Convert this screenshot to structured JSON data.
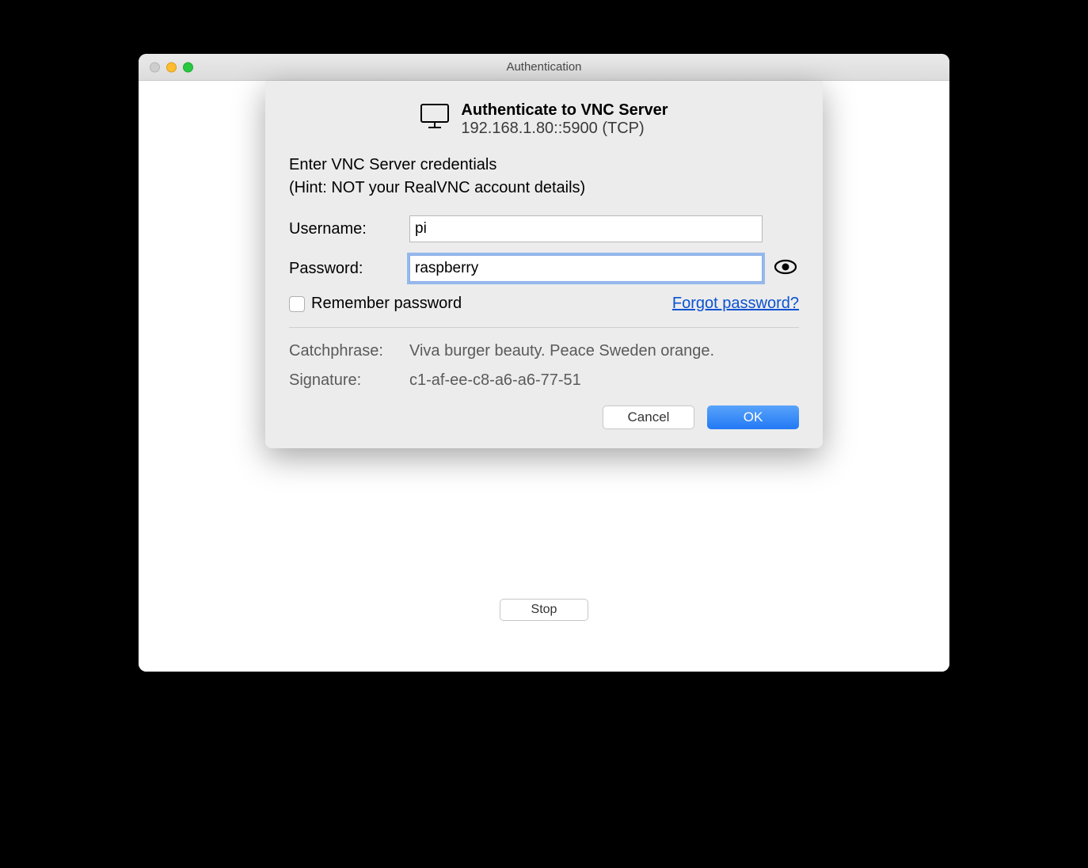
{
  "window": {
    "title": "Authentication",
    "stop_label": "Stop"
  },
  "dialog": {
    "heading": "Authenticate to VNC Server",
    "server_address": "192.168.1.80::5900 (TCP)",
    "instruction_line1": "Enter VNC Server credentials",
    "instruction_line2": "(Hint: NOT your RealVNC account details)",
    "username_label": "Username:",
    "username_value": "pi",
    "password_label": "Password:",
    "password_value": "raspberry",
    "remember_label": "Remember password",
    "forgot_link": "Forgot password?",
    "catchphrase_label": "Catchphrase:",
    "catchphrase_value": "Viva burger beauty. Peace Sweden orange.",
    "signature_label": "Signature:",
    "signature_value": "c1-af-ee-c8-a6-a6-77-51",
    "cancel_label": "Cancel",
    "ok_label": "OK"
  }
}
